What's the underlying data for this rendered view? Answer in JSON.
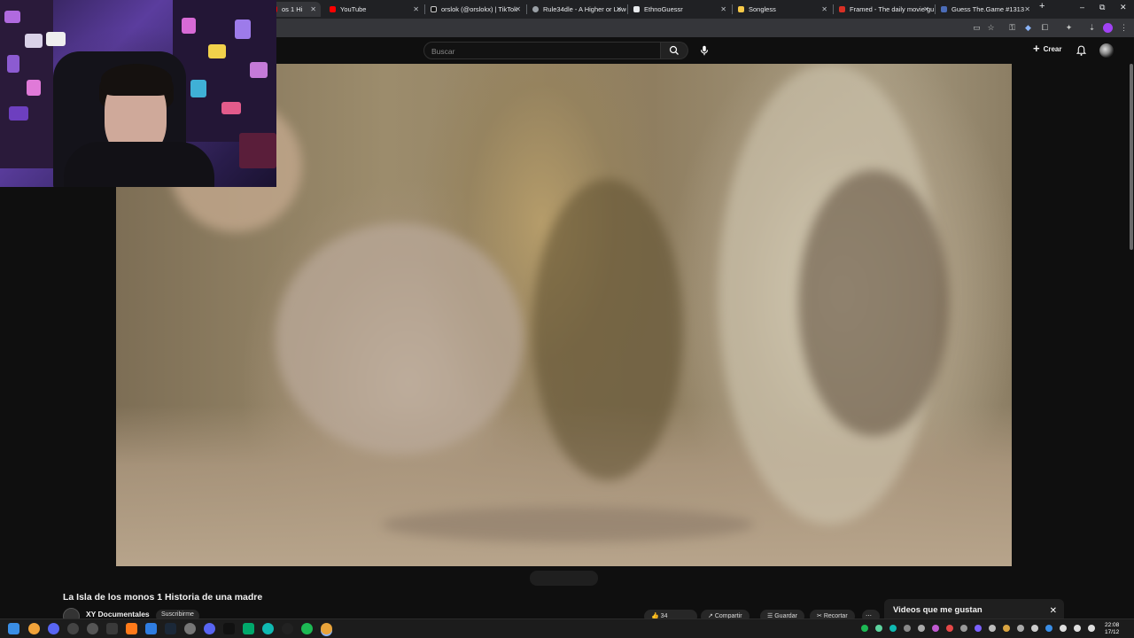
{
  "browser": {
    "tabs": [
      {
        "label": "os 1 Hi",
        "color": "#ff0000"
      },
      {
        "label": "YouTube",
        "color": "#ff0000"
      },
      {
        "label": "orslok (@orslokx) | TikTok",
        "color": "#ffffff"
      },
      {
        "label": "Rule34dle - A Higher or Lowe",
        "color": "#9aa0a6"
      },
      {
        "label": "EthnoGuessr",
        "color": "#e8eaed"
      },
      {
        "label": "Songless",
        "color": "#f7c948"
      },
      {
        "label": "Framed - The daily movie gu",
        "color": "#d93025"
      },
      {
        "label": "Guess The.Game #1313",
        "color": "#4b6cb7"
      }
    ],
    "new_tab": "+",
    "window_controls": {
      "minimize": "–",
      "maximize": "⧉",
      "close": "✕"
    }
  },
  "youtube": {
    "search_placeholder": "Buscar",
    "create_label": "Crear",
    "video_title": "La Isla de los monos 1 Historia de una madre",
    "channel_name": "XY Documentales",
    "subscribe_label": "Suscribirme",
    "actions": {
      "likes": "34",
      "share": "Compartir",
      "save": "Guardar",
      "clip": "Recortar"
    },
    "liked_panel_title": "Videos que me gustan"
  },
  "taskbar": {
    "time": "22:08",
    "date": "17/12"
  }
}
